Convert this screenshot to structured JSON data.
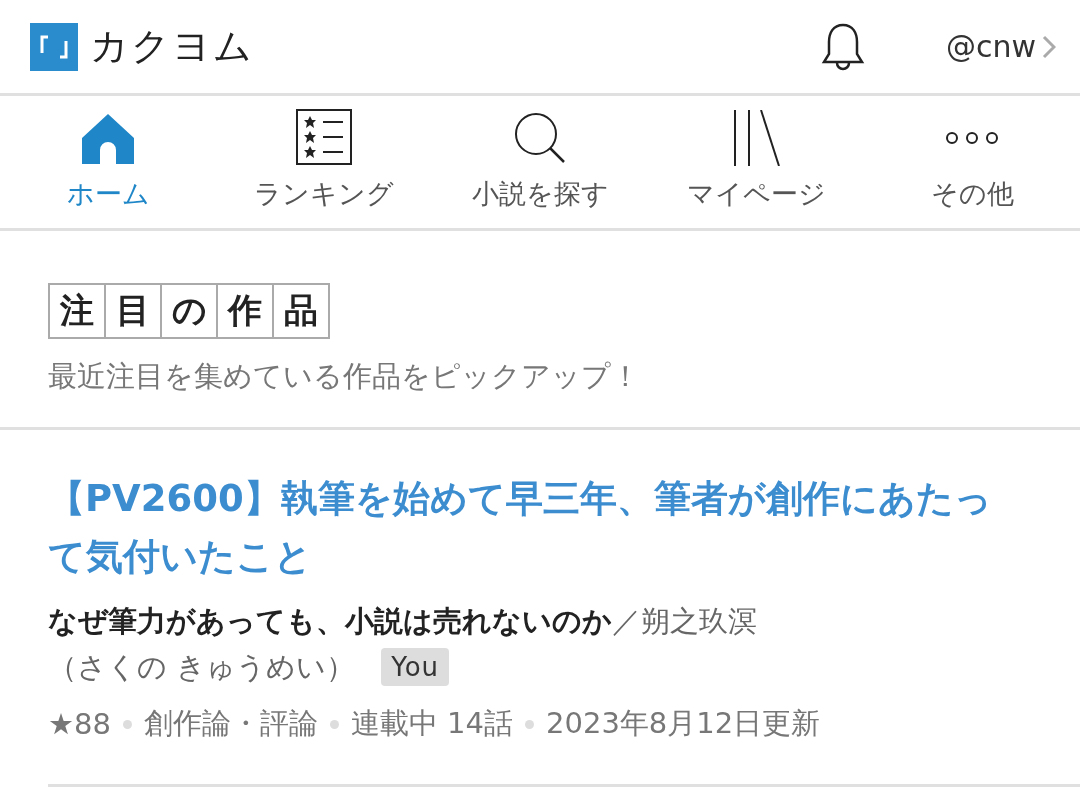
{
  "header": {
    "logo_text": "カクヨム",
    "user": "@cnw"
  },
  "nav": [
    {
      "kind": "home",
      "label": "ホーム",
      "selected": true
    },
    {
      "kind": "ranking",
      "label": "ランキング",
      "selected": false
    },
    {
      "kind": "search",
      "label": "小説を探す",
      "selected": false
    },
    {
      "kind": "shelf",
      "label": "マイページ",
      "selected": false
    },
    {
      "kind": "more",
      "label": "その他",
      "selected": false
    }
  ],
  "section": {
    "title": "注目の作品",
    "subtitle": "最近注目を集めている作品をピックアップ！"
  },
  "works": [
    {
      "title": "【PV2600】執筆を始めて早三年、筆者が創作にあたって気付いたこと",
      "catchphrase": "なぜ筆力があっても、小説は売れないのか",
      "author": "／朔之玖溟",
      "author_reading": "（さくの きゅうめい）",
      "badge": "You",
      "stars": "★88",
      "genre": "創作論・評論",
      "status": "連載中 14話",
      "updated": "2023年8月12日更新"
    }
  ]
}
